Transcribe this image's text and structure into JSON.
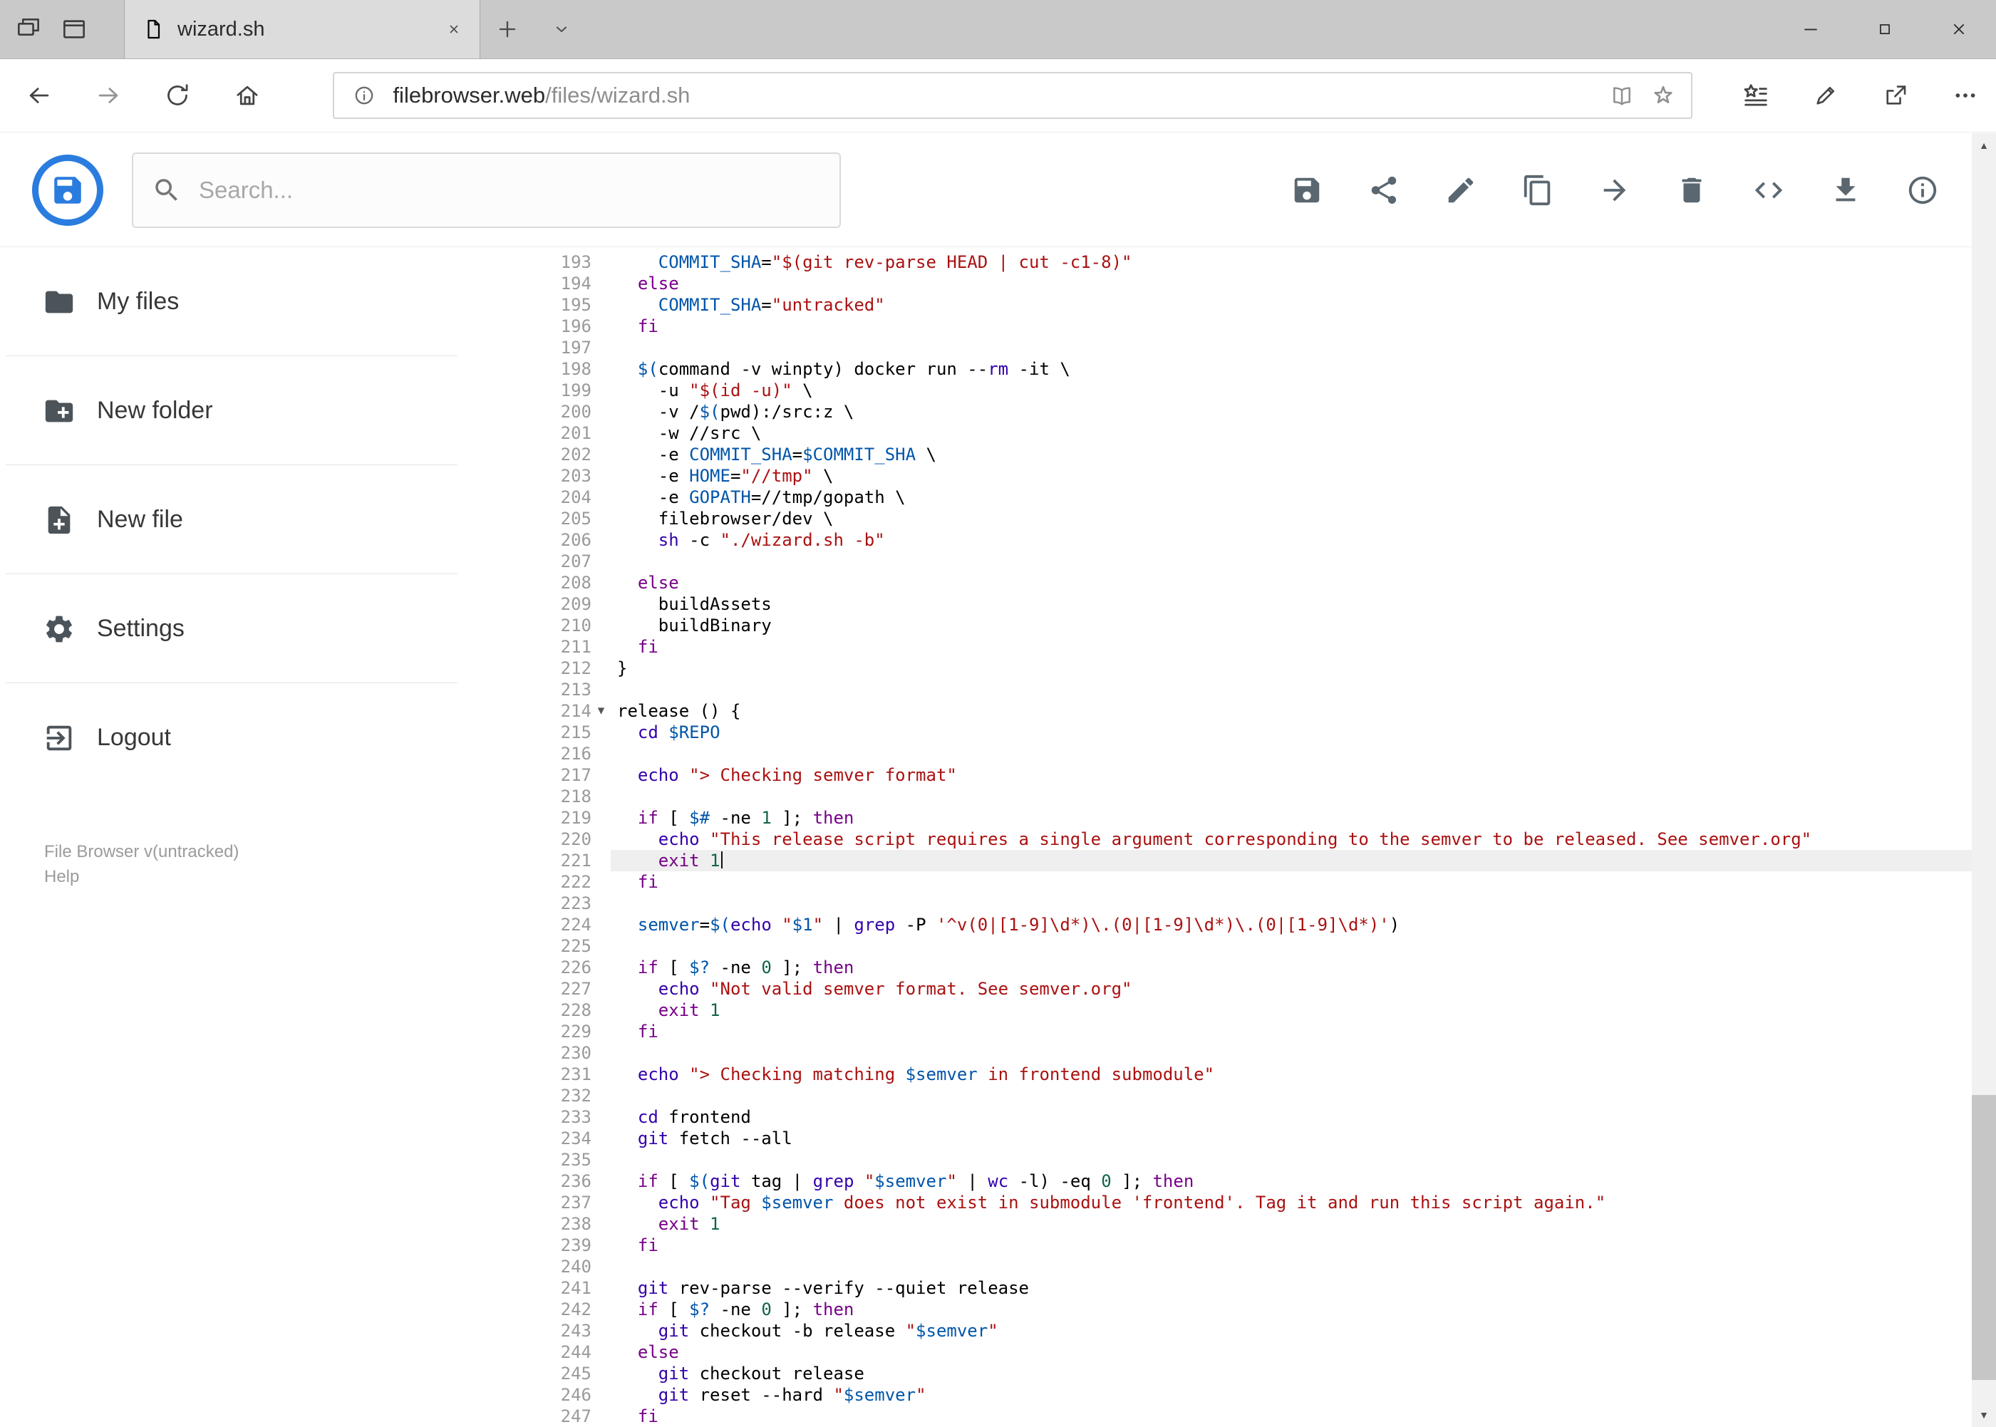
{
  "browser": {
    "tab": {
      "title": "wizard.sh"
    },
    "url": {
      "host": "filebrowser.web",
      "path": "/files/wizard.sh"
    }
  },
  "app": {
    "search": {
      "placeholder": "Search..."
    },
    "toolbar": {
      "items": [
        {
          "name": "save",
          "icon": "icon-save"
        },
        {
          "name": "share",
          "icon": "icon-share"
        },
        {
          "name": "edit",
          "icon": "icon-pencil"
        },
        {
          "name": "copy",
          "icon": "icon-copy"
        },
        {
          "name": "move",
          "icon": "icon-arrow-forward"
        },
        {
          "name": "delete",
          "icon": "icon-trash"
        },
        {
          "name": "source-code",
          "icon": "icon-code"
        },
        {
          "name": "download",
          "icon": "icon-download"
        },
        {
          "name": "info",
          "icon": "icon-info"
        }
      ]
    },
    "sidebar": {
      "items": [
        {
          "id": "my-files",
          "label": "My files",
          "icon": "icon-folder"
        },
        {
          "id": "new-folder",
          "label": "New folder",
          "icon": "icon-folder-plus"
        },
        {
          "id": "new-file",
          "label": "New file",
          "icon": "icon-file-plus"
        },
        {
          "id": "settings",
          "label": "Settings",
          "icon": "icon-gear"
        },
        {
          "id": "logout",
          "label": "Logout",
          "icon": "icon-logout"
        }
      ],
      "footer": {
        "version": "File Browser v(untracked)",
        "help": "Help"
      }
    }
  },
  "colors": {
    "accent_blue": "#2a7cdf",
    "toolbar_icon_gray": "#5a6770",
    "active_line_bg": "#efefef"
  },
  "editor": {
    "first_line": 193,
    "active_line": 221,
    "fold_marker_line": 214,
    "lines": [
      "    COMMIT_SHA=\"$(git rev-parse HEAD | cut -c1-8)\"",
      "  else",
      "    COMMIT_SHA=\"untracked\"",
      "  fi",
      "",
      "  $(command -v winpty) docker run --rm -it \\",
      "    -u \"$(id -u)\" \\",
      "    -v /$(pwd):/src:z \\",
      "    -w //src \\",
      "    -e COMMIT_SHA=$COMMIT_SHA \\",
      "    -e HOME=\"//tmp\" \\",
      "    -e GOPATH=//tmp/gopath \\",
      "    filebrowser/dev \\",
      "    sh -c \"./wizard.sh -b\"",
      "",
      "  else",
      "    buildAssets",
      "    buildBinary",
      "  fi",
      "}",
      "",
      "release () {",
      "  cd $REPO",
      "",
      "  echo \"> Checking semver format\"",
      "",
      "  if [ $# -ne 1 ]; then",
      "    echo \"This release script requires a single argument corresponding to the semver to be released. See semver.org\"",
      "    exit 1",
      "  fi",
      "",
      "  semver=$(echo \"$1\" | grep -P '^v(0|[1-9]\\d*)\\.(0|[1-9]\\d*)\\.(0|[1-9]\\d*)')",
      "",
      "  if [ $? -ne 0 ]; then",
      "    echo \"Not valid semver format. See semver.org\"",
      "    exit 1",
      "  fi",
      "",
      "  echo \"> Checking matching $semver in frontend submodule\"",
      "",
      "  cd frontend",
      "  git fetch --all",
      "",
      "  if [ $(git tag | grep \"$semver\" | wc -l) -eq 0 ]; then",
      "    echo \"Tag $semver does not exist in submodule 'frontend'. Tag it and run this script again.\"",
      "    exit 1",
      "  fi",
      "",
      "  git rev-parse --verify --quiet release",
      "  if [ $? -ne 0 ]; then",
      "    git checkout -b release \"$semver\"",
      "  else",
      "    git checkout release",
      "    git reset --hard \"$semver\"",
      "  fi"
    ]
  }
}
